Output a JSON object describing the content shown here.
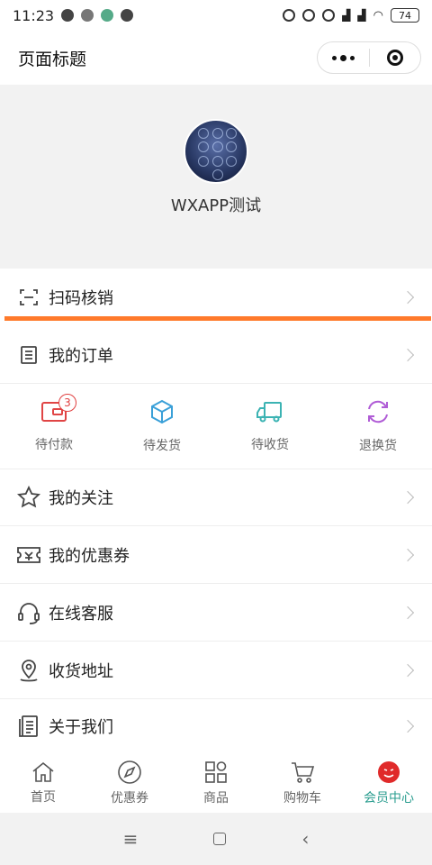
{
  "status_bar": {
    "time": "11:23",
    "battery": "74"
  },
  "header": {
    "title": "页面标题"
  },
  "profile": {
    "nickname": "WXAPP测试"
  },
  "menu": {
    "scan": "扫码核销",
    "orders": "我的订单",
    "follow": "我的关注",
    "coupons": "我的优惠券",
    "service": "在线客服",
    "address": "收货地址",
    "about": "关于我们"
  },
  "order_status": [
    {
      "label": "待付款",
      "badge": "3",
      "icon": "wallet-icon",
      "color": "#e04545"
    },
    {
      "label": "待发货",
      "icon": "box-icon",
      "color": "#3aa0d8"
    },
    {
      "label": "待收货",
      "icon": "truck-icon",
      "color": "#3bb3b3"
    },
    {
      "label": "退换货",
      "icon": "exchange-icon",
      "color": "#b05cd6"
    }
  ],
  "tabbar": [
    {
      "label": "首页",
      "icon": "home-icon"
    },
    {
      "label": "优惠券",
      "icon": "compass-icon"
    },
    {
      "label": "商品",
      "icon": "grid-icon"
    },
    {
      "label": "购物车",
      "icon": "cart-icon"
    },
    {
      "label": "会员中心",
      "icon": "member-icon",
      "active": true
    }
  ],
  "colors": {
    "accent": "#2a9d8f",
    "highlight": "#ff7a2b",
    "member": "#e02a2a"
  }
}
